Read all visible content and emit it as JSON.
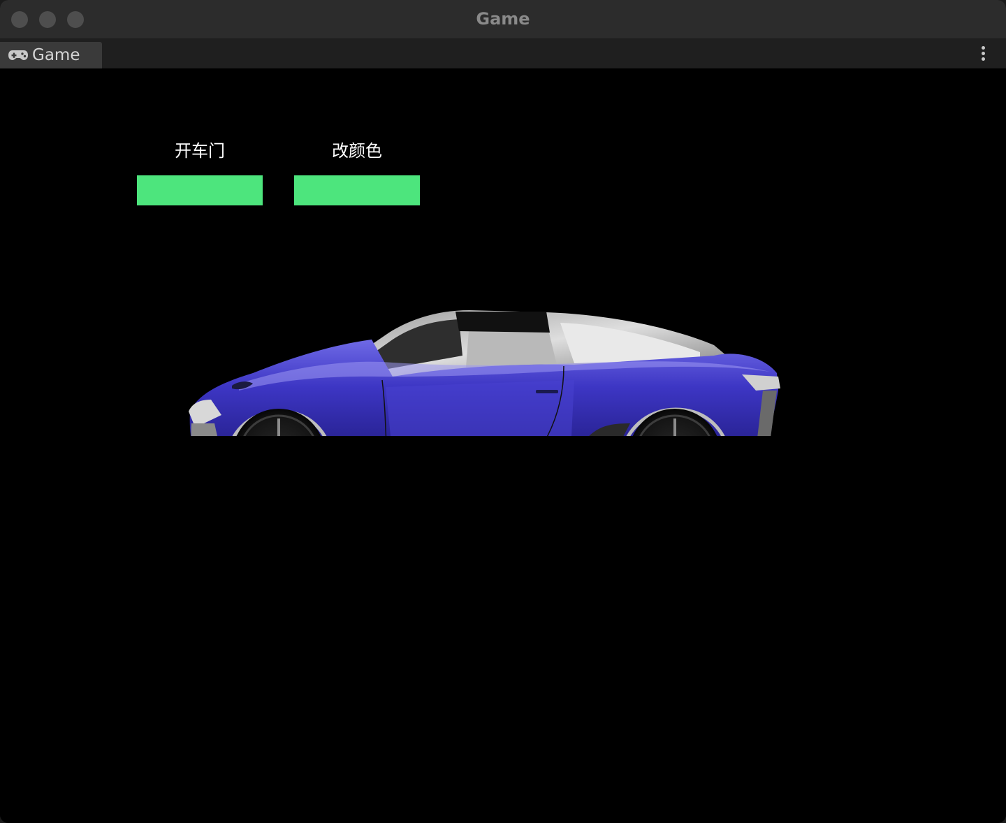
{
  "window": {
    "title": "Game"
  },
  "tabbar": {
    "tab_label": "Game",
    "tab_icon": "gamepad-icon",
    "more_icon": "vertical-ellipsis-icon"
  },
  "game": {
    "open_door_label": "开车门",
    "change_color_label": "改颜色",
    "button_color": "#4de57d",
    "car_body_color": "#3a33b8",
    "background_color": "#000000"
  }
}
